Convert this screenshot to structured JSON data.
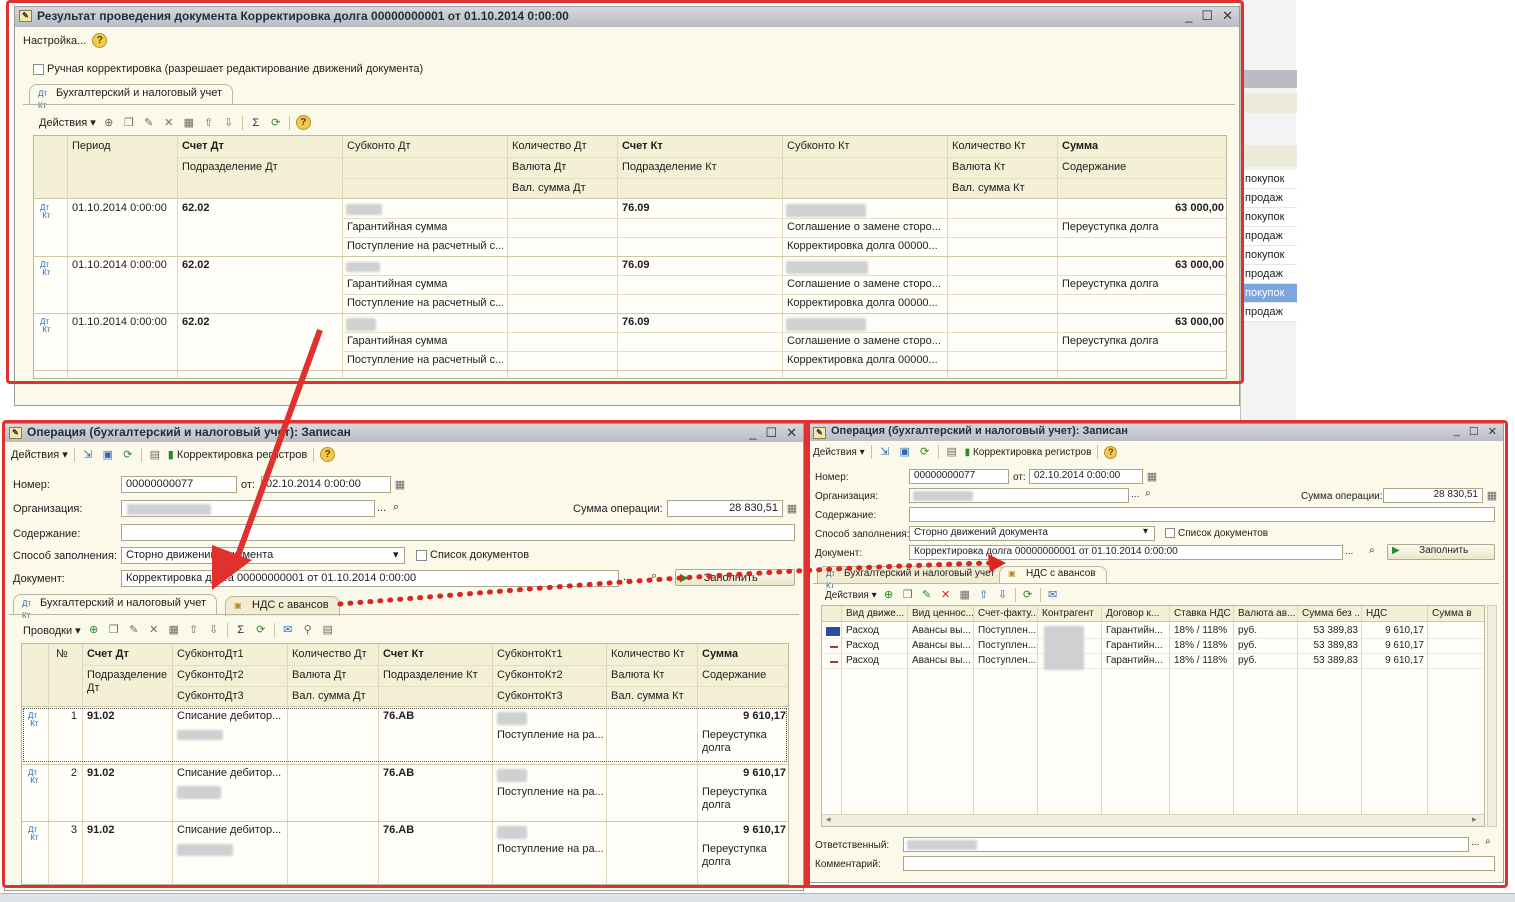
{
  "top_window": {
    "title": "Результат проведения документа Корректировка долга 00000000001 от 01.10.2014 0:00:00",
    "settings_label": "Настройка...",
    "manual_checkbox_label": "Ручная корректировка (разрешает редактирование движений документа)",
    "tab_label": "Бухгалтерский и налоговый учет",
    "actions_label": "Действия",
    "headers": {
      "period": "Период",
      "schet_dt": "Счет Дт",
      "podr_dt": "Подразделение Дт",
      "subkonto_dt": "Субконто Дт",
      "kol_dt": "Количество Дт",
      "valuta_dt": "Валюта Дт",
      "val_summa_dt": "Вал. сумма Дт",
      "schet_kt": "Счет Кт",
      "podr_kt": "Подразделение Кт",
      "subkonto_kt": "Субконто Кт",
      "kol_kt": "Количество Кт",
      "valuta_kt": "Валюта Кт",
      "val_summa_kt": "Вал. сумма Кт",
      "summa": "Сумма",
      "soderzhanie": "Содержание"
    },
    "rows": [
      {
        "period": "01.10.2014 0:00:00",
        "schet_dt": "62.02",
        "sub_dt_2": "Гарантийная сумма",
        "sub_dt_3": "Поступление на расчетный с...",
        "schet_kt": "76.09",
        "sub_kt_2": "Соглашение о замене сторо...",
        "sub_kt_3": "Корректировка долга 00000...",
        "summa": "63 000,00",
        "soderzhanie": "Переуступка долга"
      },
      {
        "period": "01.10.2014 0:00:00",
        "schet_dt": "62.02",
        "sub_dt_2": "Гарантийная сумма",
        "sub_dt_3": "Поступление на расчетный с...",
        "schet_kt": "76.09",
        "sub_kt_2": "Соглашение о замене сторо...",
        "sub_kt_3": "Корректировка долга 00000...",
        "summa": "63 000,00",
        "soderzhanie": "Переуступка долга"
      },
      {
        "period": "01.10.2014 0:00:00",
        "schet_dt": "62.02",
        "sub_dt_2": "Гарантийная сумма",
        "sub_dt_3": "Поступление на расчетный с...",
        "schet_kt": "76.09",
        "sub_kt_2": "Соглашение о замене сторо...",
        "sub_kt_3": "Корректировка долга 00000...",
        "summa": "63 000,00",
        "soderzhanie": "Переуступка долга"
      }
    ]
  },
  "bg_list": [
    "покупок",
    "продаж",
    "покупок",
    "продаж",
    "покупок",
    "продаж",
    "покупок",
    "продаж"
  ],
  "left_window": {
    "title": "Операция (бухгалтерский и налоговый учет): Записан",
    "actions_label": "Действия",
    "correction_label": "Корректировка регистров",
    "labels": {
      "number": "Номер:",
      "ot": "от:",
      "org": "Организация:",
      "sum_op": "Сумма операции:",
      "content": "Содержание:",
      "fill_method": "Способ заполнения:",
      "doc_list": "Список документов",
      "document": "Документ:",
      "fill_btn": "Заполнить"
    },
    "values": {
      "number": "00000000077",
      "date": "02.10.2014  0:00:00",
      "sum_op": "28 830,51",
      "fill_method": "Сторно движений документа",
      "document": "Корректировка долга 00000000001 от 01.10.2014 0:00:00"
    },
    "tabs": [
      "Бухгалтерский и налоговый учет",
      "НДС с авансов"
    ],
    "provodki_label": "Проводки",
    "headers": {
      "num": "№",
      "schet_dt": "Счет Дт",
      "podr_dt": "Подразделение Дт",
      "sub_dt1": "СубконтоДт1",
      "sub_dt2": "СубконтоДт2",
      "sub_dt3": "СубконтоДт3",
      "kol_dt": "Количество Дт",
      "valuta_dt": "Валюта Дт",
      "val_summa_dt": "Вал. сумма Дт",
      "schet_kt": "Счет Кт",
      "podr_kt": "Подразделение Кт",
      "sub_kt1": "СубконтоКт1",
      "sub_kt2": "СубконтоКт2",
      "sub_kt3": "СубконтоКт3",
      "kol_kt": "Количество Кт",
      "valuta_kt": "Валюта Кт",
      "val_summa_kt": "Вал. сумма Кт",
      "summa": "Сумма",
      "soderzhanie": "Содержание"
    },
    "rows": [
      {
        "num": "1",
        "schet_dt": "91.02",
        "sub_dt1": "Списание дебитор...",
        "schet_kt": "76.АВ",
        "sub_kt2": "Поступление на ра...",
        "summa": "9 610,17",
        "soderzhanie": "Переуступка долга"
      },
      {
        "num": "2",
        "schet_dt": "91.02",
        "sub_dt1": "Списание дебитор...",
        "schet_kt": "76.АВ",
        "sub_kt2": "Поступление на ра...",
        "summa": "9 610,17",
        "soderzhanie": "Переуступка долга"
      },
      {
        "num": "3",
        "schet_dt": "91.02",
        "sub_dt1": "Списание дебитор...",
        "schet_kt": "76.АВ",
        "sub_kt2": "Поступление на ра...",
        "summa": "9 610,17",
        "soderzhanie": "Переуступка долга"
      }
    ]
  },
  "right_window": {
    "title": "Операция (бухгалтерский и налоговый учет): Записан",
    "actions_label": "Действия",
    "correction_label": "Корректировка регистров",
    "labels": {
      "number": "Номер:",
      "ot": "от:",
      "org": "Организация:",
      "sum_op": "Сумма операции:",
      "content": "Содержание:",
      "fill_method": "Способ заполнения:",
      "doc_list": "Список документов",
      "document": "Документ:",
      "fill_btn": "Заполнить",
      "responsible": "Ответственный:",
      "comment": "Комментарий:"
    },
    "values": {
      "number": "00000000077",
      "date": "02.10.2014  0:00:00",
      "sum_op": "28 830,51",
      "fill_method": "Сторно движений документа",
      "document": "Корректировка долга 00000000001 от 01.10.2014 0:00:00"
    },
    "tabs": [
      "Бухгалтерский и налоговый учет",
      "НДС с авансов"
    ],
    "headers": [
      "Вид движе...",
      "Вид ценнос...",
      "Счет-факту...",
      "Контрагент",
      "Договор к...",
      "Ставка НДС",
      "Валюта ав...",
      "Сумма без ...",
      "НДС",
      "Сумма в"
    ],
    "rows": [
      {
        "vid": "Расход",
        "cen": "Авансы вы...",
        "sf": "Поступлен...",
        "dog": "Гарантийн...",
        "stavka": "18% / 118%",
        "val": "руб.",
        "sum": "53 389,83",
        "nds": "9 610,17"
      },
      {
        "vid": "Расход",
        "cen": "Авансы вы...",
        "sf": "Поступлен...",
        "dog": "Гарантийн...",
        "stavka": "18% / 118%",
        "val": "руб.",
        "sum": "53 389,83",
        "nds": "9 610,17"
      },
      {
        "vid": "Расход",
        "cen": "Авансы вы...",
        "sf": "Поступлен...",
        "dog": "Гарантийн...",
        "stavka": "18% / 118%",
        "val": "руб.",
        "sum": "53 389,83",
        "nds": "9 610,17"
      }
    ]
  },
  "colors": {
    "highlight": "#e0312e",
    "window_bg": "#fbf9ea",
    "header_bg": "#f4f0d6",
    "title_bg": "#c4c7cc"
  }
}
